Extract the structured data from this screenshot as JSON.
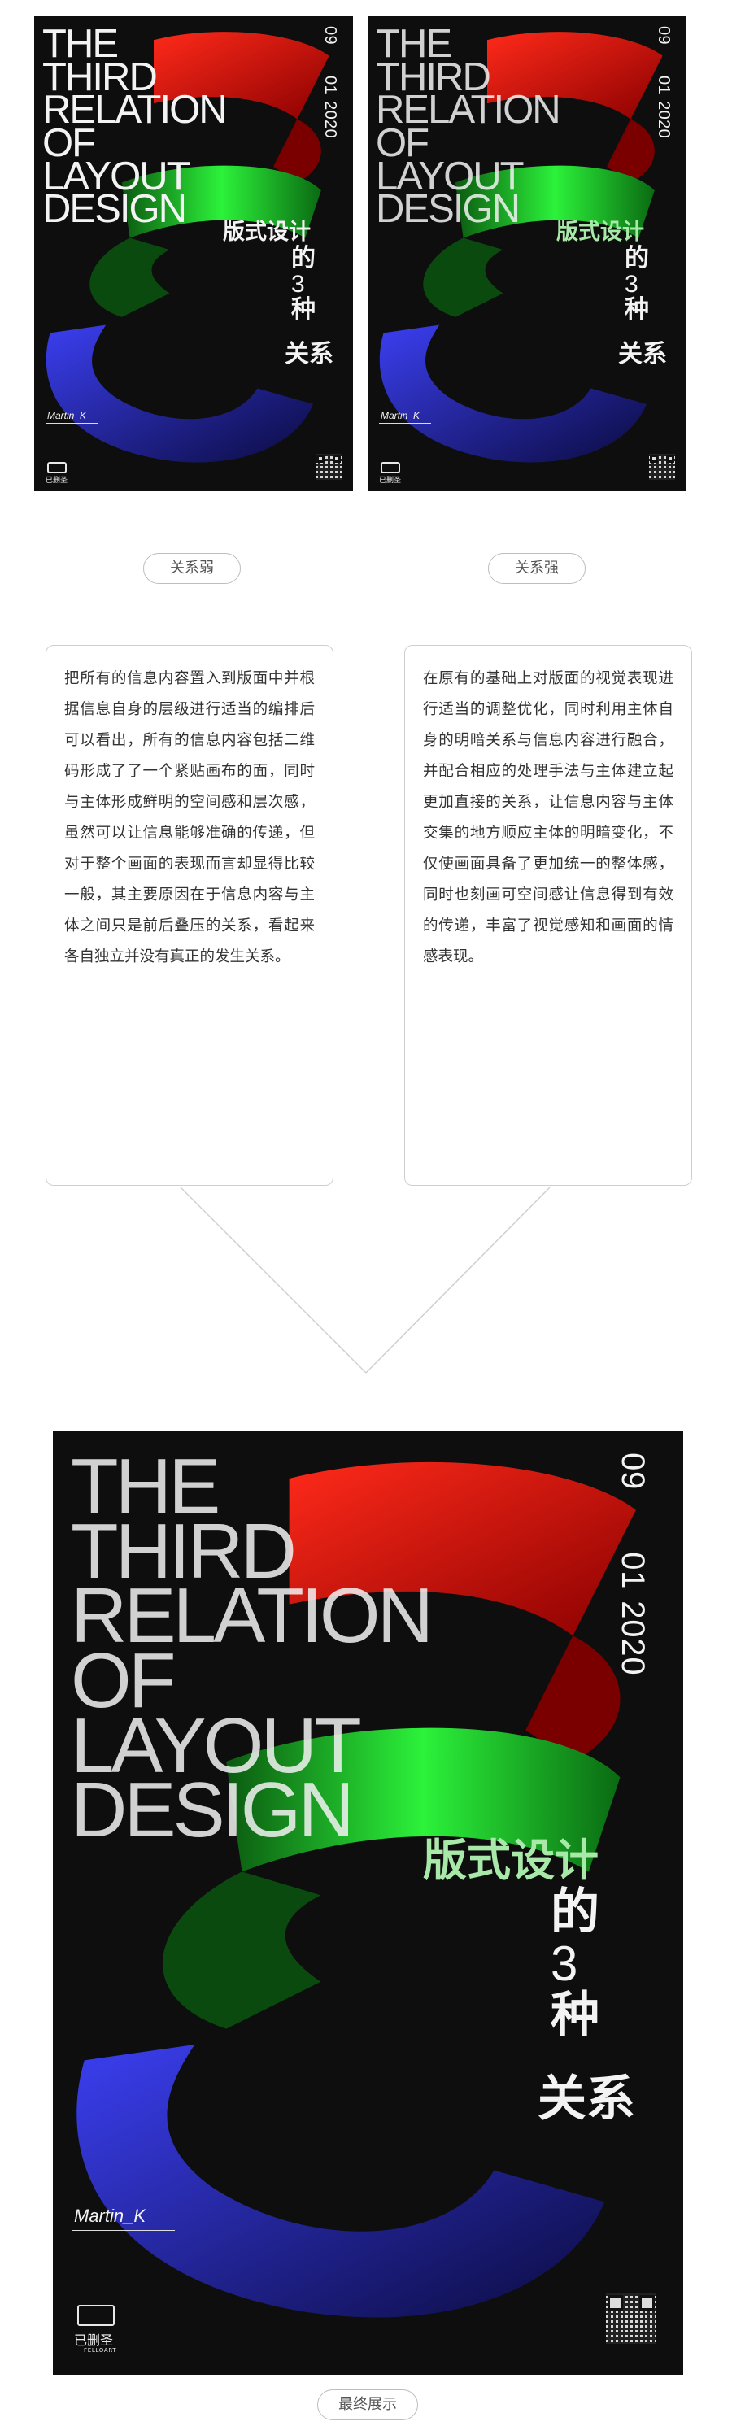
{
  "poster": {
    "title_lines": [
      "THE",
      "THIRD",
      "RELATION",
      "OF",
      "LAYOUT",
      "DESIGN"
    ],
    "cn_line1": "版式设计",
    "cn_line2": "的",
    "cn_num": "3",
    "cn_line3": "种",
    "cn_line4": "关系",
    "date_month": "09",
    "date_day": "01",
    "date_year": "2020",
    "author": "Martin_K",
    "logo_mark": "i5",
    "logo_text": "已删圣",
    "logo_sub": "FELLOART",
    "colors": {
      "background": "#0e0e0e",
      "red": "#e8120c",
      "green": "#17e62a",
      "blue": "#2c2fd8"
    }
  },
  "labels": {
    "weak": "关系弱",
    "strong": "关系强",
    "final": "最终展示"
  },
  "texts": {
    "weak": "把所有的信息内容置入到版面中并根据信息自身的层级进行适当的编排后可以看出，所有的信息内容包括二维码形成了了一个紧贴画布的面，同时与主体形成鲜明的空间感和层次感，虽然可以让信息能够准确的传递，但对于整个画面的表现而言却显得比较一般，其主要原因在于信息内容与主体之间只是前后叠压的关系，看起来各自独立并没有真正的发生关系。",
    "strong": "在原有的基础上对版面的视觉表现进行适当的调整优化，同时利用主体自身的明暗关系与信息内容进行融合，并配合相应的处理手法与主体建立起更加直接的关系，让信息内容与主体交集的地方顺应主体的明暗变化，不仅使画面具备了更加统一的整体感，同时也刻画可空间感让信息得到有效的传递，丰富了视觉感知和画面的情感表现。"
  }
}
